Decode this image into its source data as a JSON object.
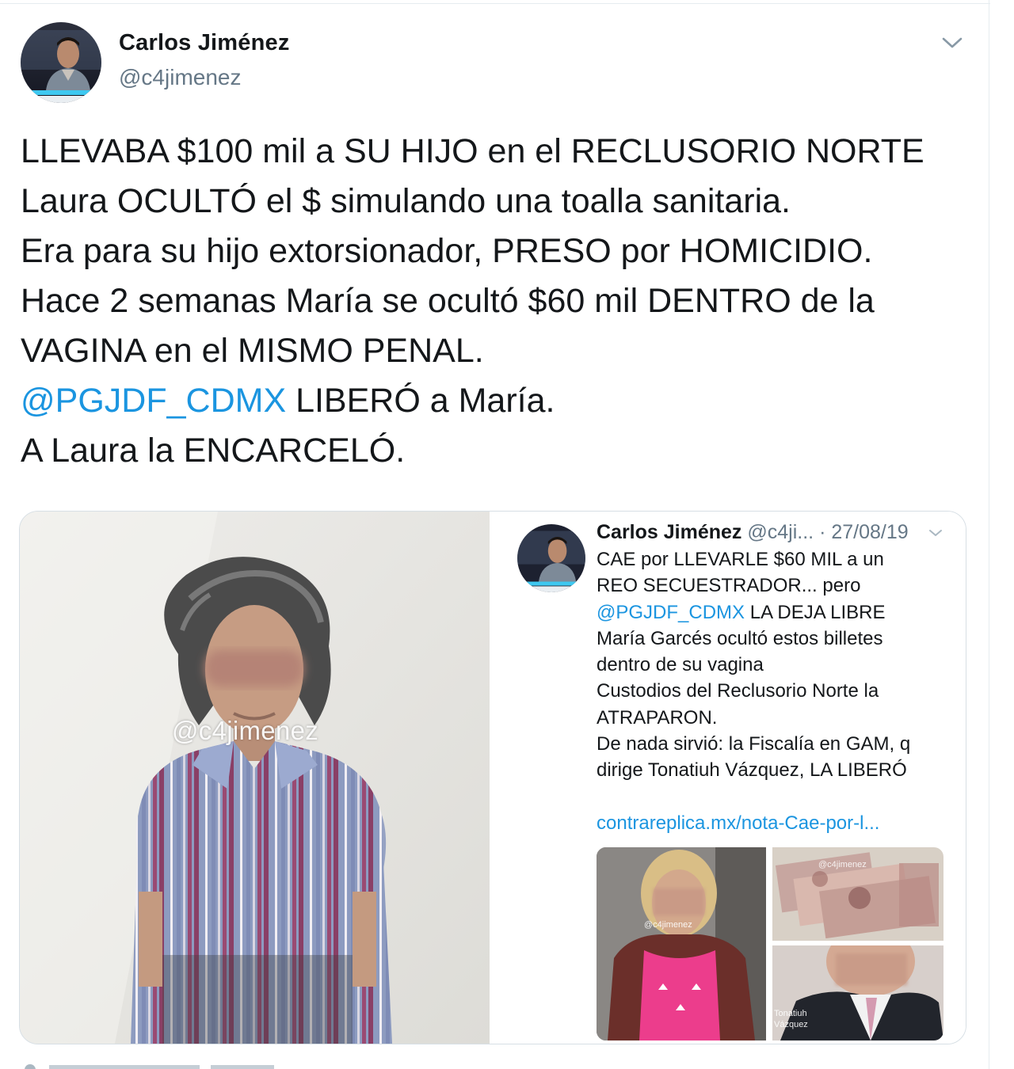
{
  "tweet": {
    "author": {
      "name": "Carlos Jiménez",
      "handle": "@c4jimenez"
    },
    "text_lines": [
      [
        {
          "text": "LLEVABA $100 mil a SU HIJO en el RECLUSORIO NORTE"
        }
      ],
      [
        {
          "text": "Laura OCULTÓ el $ simulando una toalla sanitaria."
        }
      ],
      [
        {
          "text": "Era para su hijo extorsionador, PRESO por HOMICIDIO."
        }
      ],
      [
        {
          "text": "Hace 2 semanas María se ocultó $60 mil DENTRO de la"
        }
      ],
      [
        {
          "text": "VAGINA en el MISMO PENAL."
        }
      ],
      [
        {
          "text": "@PGJDF_CDMX",
          "mention": true
        },
        {
          "text": " LIBERÓ a María."
        }
      ],
      [
        {
          "text": "A Laura la ENCARCELÓ."
        }
      ]
    ]
  },
  "media": {
    "photo": {
      "watermark": "@c4jimenez"
    },
    "quoted_tweet": {
      "author_name": "Carlos Jiménez",
      "handle": "@c4ji...",
      "date": "· 27/08/19",
      "text_lines": [
        [
          {
            "text": "CAE por LLEVARLE $60 MIL a un"
          }
        ],
        [
          {
            "text": "REO SECUESTRADOR... pero"
          }
        ],
        [
          {
            "text": "@PGJDF_CDMX",
            "mention": true
          },
          {
            "text": " LA DEJA LIBRE"
          }
        ],
        [
          {
            "text": "María Garcés ocultó estos billetes"
          }
        ],
        [
          {
            "text": "dentro de su vagina"
          }
        ],
        [
          {
            "text": "Custodios del Reclusorio Norte la"
          }
        ],
        [
          {
            "text": "ATRAPARON."
          }
        ],
        [
          {
            "text": "De nada sirvió: la Fiscalía en GAM, q"
          }
        ],
        [
          {
            "text": "dirige Tonatiuh Vázquez, LA LIBERÓ"
          }
        ]
      ],
      "link": "contrareplica.mx/nota-Cae-por-l...",
      "images": {
        "woman_watermark": "@c4jimenez",
        "money_watermark": "@c4jimenez",
        "man_caption_line1": "Tonatiuh",
        "man_caption_line2": "Vázquez"
      }
    }
  },
  "colors": {
    "text": "#14171a",
    "secondary_text": "#657786",
    "link": "#1b95e0",
    "border": "#d7dfe5"
  },
  "icons": {
    "tweet_menu": "chevron-down-icon",
    "quoted_menu": "chevron-down-icon"
  }
}
